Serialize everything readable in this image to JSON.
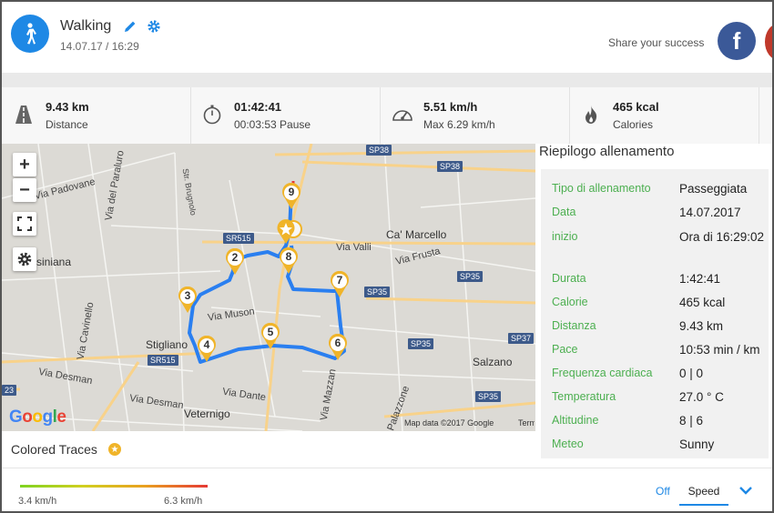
{
  "header": {
    "activity_icon": "walking-person-icon",
    "title": "Walking",
    "datetime": "14.07.17 / 16:29",
    "edit_icon": "pencil-icon",
    "settings_icon": "gear-icon",
    "share_label": "Share your success",
    "facebook_letter": "f"
  },
  "stats": [
    {
      "icon": "road-icon",
      "value": "9.43 km",
      "label": "Distance"
    },
    {
      "icon": "stopwatch-icon",
      "value": "01:42:41",
      "label": "00:03:53 Pause"
    },
    {
      "icon": "speedometer-icon",
      "value": "5.51 km/h",
      "label": "Max 6.29 km/h"
    },
    {
      "icon": "flame-icon",
      "value": "465 kcal",
      "label": "Calories"
    }
  ],
  "map": {
    "zoom_in": "+",
    "zoom_out": "−",
    "places": [
      "Via Padovane",
      "Via del Paraluro",
      "Str. Brugnolo",
      "SR515",
      "SP38",
      "SP38",
      "Ca' Marcello",
      "Via Valli",
      "Via Frusta",
      "Stigliano",
      "Via Muson",
      "Via Cavinello",
      "Via Desman",
      "Via Desman",
      "Via Dante",
      "Veternigo",
      "Via Mazzan",
      "Salzano",
      "Palazzone",
      "SP35",
      "SP35",
      "SP35",
      "SP37",
      "SP35",
      "SR515",
      "23",
      "Asiniana"
    ],
    "markers": [
      "2",
      "3",
      "4",
      "5",
      "6",
      "7",
      "8",
      "9"
    ],
    "google_text": "Google",
    "credit": "Map data ©2017 Google",
    "terms": "Terms"
  },
  "summary": {
    "title": "Riepilogo allenamento",
    "rows": [
      {
        "key": "Tipo di allenamento",
        "value": "Passeggiata"
      },
      {
        "key": "Data",
        "value": "14.07.2017"
      },
      {
        "key": "inizio",
        "value": "Ora di 16:29:02"
      },
      {
        "key": "Durata",
        "value": "1:42:41"
      },
      {
        "key": "Calorie",
        "value": "465 kcal"
      },
      {
        "key": "Distanza",
        "value": "9.43 km"
      },
      {
        "key": "Pace",
        "value": "10:53 min / km"
      },
      {
        "key": "Frequenza cardiaca",
        "value": "0 | 0"
      },
      {
        "key": "Temperatura",
        "value": "27.0 ° C"
      },
      {
        "key": "Altitudine",
        "value": "8 | 6"
      },
      {
        "key": "Meteo",
        "value": "Sunny"
      }
    ]
  },
  "traces": {
    "label": "Colored Traces",
    "min_speed": "3.4 km/h",
    "max_speed": "6.3 km/h",
    "off_label": "Off",
    "speed_label": "Speed"
  },
  "colors": {
    "accent": "#1e88e5",
    "facebook": "#3b5998",
    "summary_key": "#4caf50",
    "route": "#2a7ff0",
    "marker": "#f0b429"
  }
}
